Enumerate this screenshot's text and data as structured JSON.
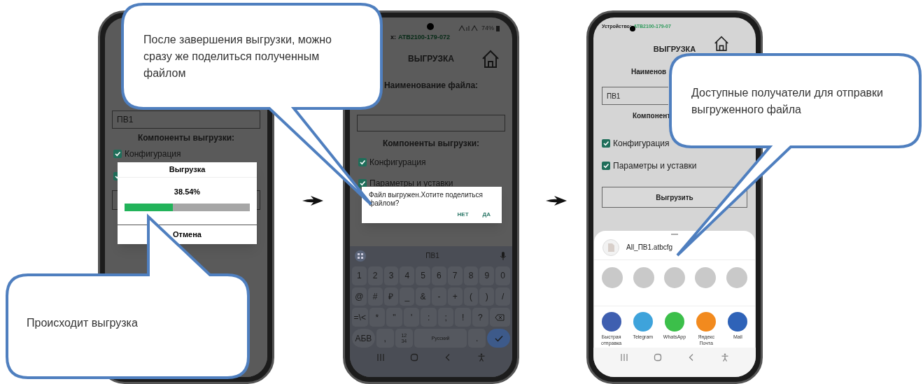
{
  "phone_upload_progress": {
    "field_value": "ПВ1",
    "section_title": "Компоненты выгрузки:",
    "options": [
      {
        "label": "Конфигурация",
        "checked": true
      },
      {
        "checked": true
      }
    ],
    "dialog": {
      "title": "Выгрузка",
      "percent": "38.54%",
      "level": 0.3854,
      "cancel": "Отмена"
    }
  },
  "phone_share_prompt": {
    "status": {
      "device_prefix": "х:",
      "device": "ATB2100-179-072",
      "battery": "74%"
    },
    "title": "ВЫГРУЗКА",
    "file_label": "Наименование файла:",
    "section_title": "Компоненты выгрузки:",
    "options": [
      {
        "label": "Конфигурация",
        "checked": true
      },
      {
        "label": "Параметры и уставки",
        "checked": true
      }
    ],
    "dialog": {
      "message": "Файл выгружен.Хотите поделиться файлом?",
      "buttons": [
        "НЕТ",
        "ДА"
      ]
    },
    "keyboard": {
      "suggestion": "ПВ1",
      "key_rows": [
        {
          "keys": [
            "1",
            "2",
            "3",
            "4",
            "5",
            "6",
            "7",
            "8",
            "9",
            "0"
          ]
        },
        {
          "keys": [
            "@",
            "#",
            "₽",
            "_",
            "&",
            "-",
            "+",
            "(",
            ")",
            "/"
          ]
        },
        {
          "keys": [
            "=\\<",
            "*",
            "\"",
            "'",
            ":",
            ";",
            "!",
            "?"
          ]
        },
        {
          "keys": [
            "АБВ",
            ",",
            "12\n34",
            "Русский",
            "."
          ]
        }
      ]
    }
  },
  "phone_share_sheet": {
    "status": {
      "device_label": "Устройство:",
      "device": "ATB2100-179-07"
    },
    "title": "ВЫГРУЗКА",
    "file_label": "Наименов",
    "field_value": "ПВ1",
    "section_title": "Компонент",
    "options": [
      {
        "label": "Конфигурация",
        "checked": true
      },
      {
        "label": "Параметры и уставки",
        "checked": true
      }
    ],
    "button": "Выгрузить",
    "sheet": {
      "file_name": "All_ПВ1.atbcfg",
      "apps": [
        {
          "label": "Быстрая отправка",
          "color": "#3f5fb0"
        },
        {
          "label": "Telegram",
          "color": "#3ea3db"
        },
        {
          "label": "WhatsApp",
          "color": "#3cbf4a"
        },
        {
          "label": "Яндекс Почта",
          "color": "#f28a1e"
        },
        {
          "label": "Mail",
          "color": "#2f63b8"
        }
      ]
    }
  },
  "callouts": [
    {
      "text": "После завершения выгрузки, можно сразу же поделиться полученным файлом"
    },
    {
      "text": "Происходит выгрузка"
    },
    {
      "text": "Доступные получатели для отправки выгруженного файла"
    }
  ]
}
